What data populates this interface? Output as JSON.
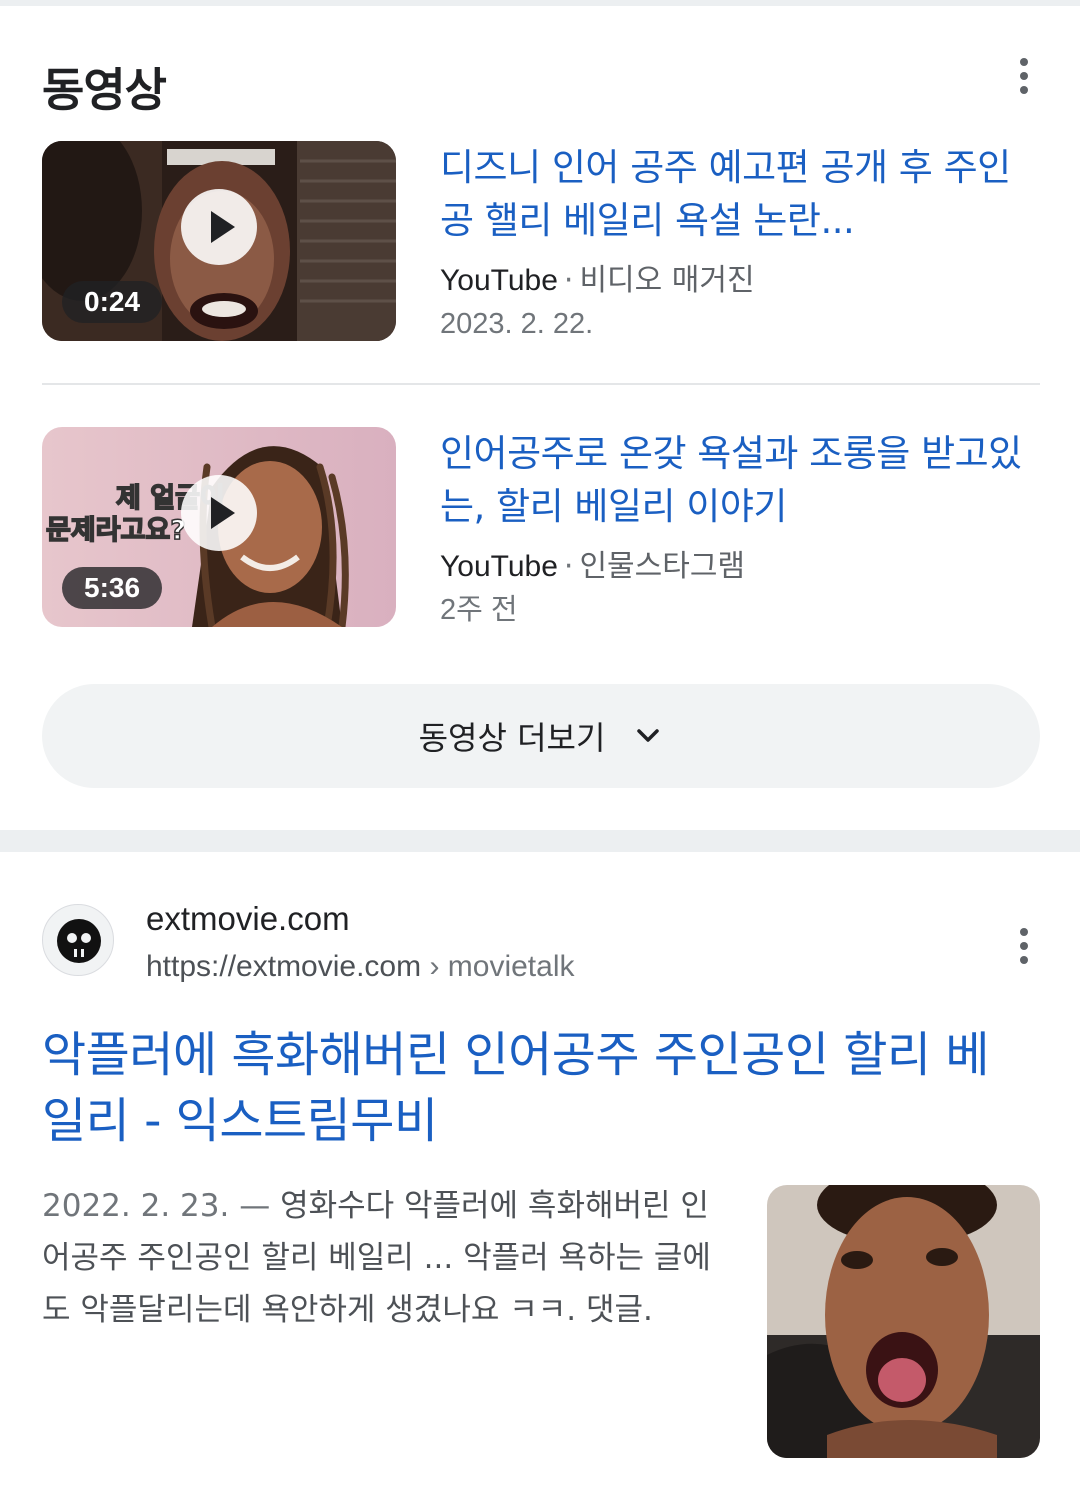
{
  "videos_section": {
    "title": "동영상",
    "items": [
      {
        "title": "디즈니 인어 공주 예고편 공개 후 주인공 핼리 베일리 욕설 논란...",
        "source": "YouTube",
        "channel": "비디오 매거진",
        "date": "2023. 2. 22.",
        "duration": "0:24",
        "thumbnail_text": ""
      },
      {
        "title": "인어공주로 온갖 욕설과 조롱을 받고있는, 할리 베일리 이야기",
        "source": "YouTube",
        "channel": "인물스타그램",
        "date": "2주 전",
        "duration": "5:36",
        "thumbnail_text_line1": "제 얼굴이",
        "thumbnail_text_line2": "문제라고요?"
      }
    ],
    "more_button": "동영상 더보기"
  },
  "result": {
    "site_name": "extmovie.com",
    "url": "https://extmovie.com",
    "breadcrumb": "› movietalk",
    "title": "악플러에 흑화해버린 인어공주 주인공인 할리 베일리 - 익스트림무비",
    "snippet_date": "2022. 2. 23.",
    "snippet_separator": "—",
    "snippet": "영화수다 악플러에 흑화해버린 인어공주 주인공인 할리 베일리 ... 악플러 욕하는 글에도 악플달리는데 욕안하게 생겼나요 ㅋㅋ. 댓글."
  },
  "colors": {
    "link": "#1a5fc2",
    "text": "#202124",
    "secondary": "#70757a",
    "button_bg": "#f1f3f4",
    "section_gap": "#eceff1"
  },
  "icons": {
    "menu": "more-vert-icon",
    "play": "play-icon",
    "expand": "chevron-down-icon",
    "favicon": "skull-icon"
  }
}
